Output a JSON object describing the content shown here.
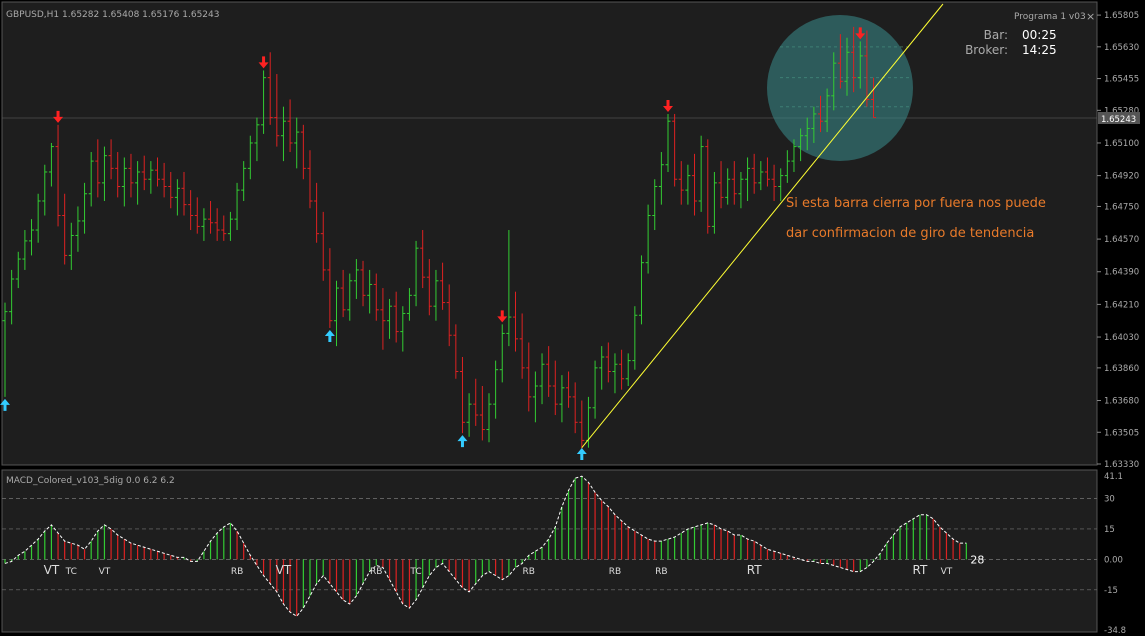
{
  "main_panel": {
    "header": "GBPUSD,H1  1.65282 1.65408 1.65176 1.65243",
    "indicator_name": "Programa 1 v03",
    "close_glyph": "×",
    "bar_label": "Bar:",
    "bar_value": "00:25",
    "broker_label": "Broker:",
    "broker_value": "14:25",
    "current_price_tag": "1.65243",
    "annotation_line1": "Si esta barra cierra por fuera nos puede",
    "annotation_line2": "dar confirmacion de giro de tendencia",
    "price_ticks": [
      "1.65805",
      "1.65630",
      "1.65455",
      "1.65280",
      "1.65100",
      "1.64920",
      "1.64750",
      "1.64570",
      "1.64390",
      "1.64210",
      "1.64030",
      "1.63860",
      "1.63680",
      "1.63505",
      "1.63330"
    ]
  },
  "sub_panel": {
    "header": "MACD_Colored_v103_5dig 0.0 6.2 6.2",
    "ticks": [
      "41.1",
      "30",
      "15",
      "0.00",
      "-15",
      "-34.8"
    ],
    "labels": [
      {
        "text": "VT",
        "bar": 7
      },
      {
        "text": "TC",
        "bar": 10
      },
      {
        "text": "VT",
        "bar": 15
      },
      {
        "text": "RB",
        "bar": 35
      },
      {
        "text": "VT",
        "bar": 42
      },
      {
        "text": "RB",
        "bar": 56
      },
      {
        "text": "TC",
        "bar": 62
      },
      {
        "text": "RB",
        "bar": 79
      },
      {
        "text": "RB",
        "bar": 92
      },
      {
        "text": "RB",
        "bar": 99
      },
      {
        "text": "RT",
        "bar": 113
      },
      {
        "text": "RT",
        "bar": 138
      },
      {
        "text": "VT",
        "bar": 142
      }
    ],
    "last_value": "28"
  },
  "colors": {
    "background": "#000000",
    "panel_bg": "#1e1e1e",
    "up_bar": "#33cc33",
    "down_bar": "#dd2222",
    "arrow_up": "#33ccff",
    "arrow_down": "#ff2222",
    "trendline": "#ffff33",
    "annotation_text": "#e87a2a",
    "highlight_circle": "#3a8e8e",
    "text": "#aaaaaa"
  },
  "chart_data": {
    "type": "ohlc",
    "symbol": "GBPUSD",
    "timeframe": "H1",
    "y_range": [
      1.6333,
      1.658
    ],
    "bars": [
      [
        1.6412,
        1.6422,
        1.637,
        1.6417
      ],
      [
        1.6417,
        1.644,
        1.641,
        1.6435
      ],
      [
        1.6435,
        1.645,
        1.643,
        1.6446
      ],
      [
        1.6446,
        1.6462,
        1.644,
        1.6456
      ],
      [
        1.6456,
        1.6468,
        1.6448,
        1.6462
      ],
      [
        1.6462,
        1.6482,
        1.6455,
        1.6478
      ],
      [
        1.6478,
        1.6498,
        1.647,
        1.6494
      ],
      [
        1.6494,
        1.651,
        1.6486,
        1.6508
      ],
      [
        1.6508,
        1.652,
        1.6464,
        1.647
      ],
      [
        1.647,
        1.6482,
        1.6443,
        1.6448
      ],
      [
        1.6448,
        1.6466,
        1.644,
        1.6459
      ],
      [
        1.6459,
        1.6475,
        1.645,
        1.6467
      ],
      [
        1.6467,
        1.6488,
        1.646,
        1.6482
      ],
      [
        1.6482,
        1.6505,
        1.6475,
        1.65
      ],
      [
        1.65,
        1.6512,
        1.648,
        1.6488
      ],
      [
        1.6488,
        1.6508,
        1.6478,
        1.6503
      ],
      [
        1.6503,
        1.6512,
        1.649,
        1.6496
      ],
      [
        1.6496,
        1.6505,
        1.648,
        1.6486
      ],
      [
        1.6486,
        1.6502,
        1.6475,
        1.6496
      ],
      [
        1.6496,
        1.6504,
        1.648,
        1.6488
      ],
      [
        1.6488,
        1.65,
        1.6476,
        1.6494
      ],
      [
        1.6494,
        1.6503,
        1.6484,
        1.649
      ],
      [
        1.649,
        1.65,
        1.6482,
        1.6495
      ],
      [
        1.6495,
        1.6502,
        1.6486,
        1.649
      ],
      [
        1.649,
        1.6499,
        1.648,
        1.6486
      ],
      [
        1.6486,
        1.6494,
        1.6474,
        1.648
      ],
      [
        1.648,
        1.649,
        1.647,
        1.6485
      ],
      [
        1.6485,
        1.6494,
        1.647,
        1.6476
      ],
      [
        1.6476,
        1.6484,
        1.6462,
        1.647
      ],
      [
        1.647,
        1.648,
        1.646,
        1.6464
      ],
      [
        1.6464,
        1.6474,
        1.6456,
        1.6468
      ],
      [
        1.6468,
        1.6478,
        1.646,
        1.6466
      ],
      [
        1.6466,
        1.6474,
        1.6456,
        1.6462
      ],
      [
        1.6462,
        1.647,
        1.6456,
        1.646
      ],
      [
        1.646,
        1.6472,
        1.6456,
        1.6468
      ],
      [
        1.6468,
        1.6488,
        1.6462,
        1.6484
      ],
      [
        1.6484,
        1.65,
        1.6478,
        1.6496
      ],
      [
        1.6496,
        1.6514,
        1.649,
        1.651
      ],
      [
        1.651,
        1.6524,
        1.65,
        1.652
      ],
      [
        1.652,
        1.655,
        1.6515,
        1.6546
      ],
      [
        1.6546,
        1.656,
        1.652,
        1.6524
      ],
      [
        1.6524,
        1.6548,
        1.6508,
        1.6514
      ],
      [
        1.6514,
        1.653,
        1.65,
        1.6522
      ],
      [
        1.6522,
        1.6534,
        1.6505,
        1.651
      ],
      [
        1.651,
        1.6524,
        1.6496,
        1.6516
      ],
      [
        1.6516,
        1.652,
        1.649,
        1.6496
      ],
      [
        1.6496,
        1.6506,
        1.6474,
        1.6478
      ],
      [
        1.6478,
        1.6488,
        1.6455,
        1.646
      ],
      [
        1.646,
        1.6472,
        1.6434,
        1.644
      ],
      [
        1.644,
        1.6452,
        1.6408,
        1.6412
      ],
      [
        1.6412,
        1.6434,
        1.6398,
        1.643
      ],
      [
        1.643,
        1.644,
        1.6414,
        1.6418
      ],
      [
        1.6418,
        1.6438,
        1.6412,
        1.6434
      ],
      [
        1.6434,
        1.6446,
        1.6424,
        1.644
      ],
      [
        1.644,
        1.6445,
        1.642,
        1.6426
      ],
      [
        1.6426,
        1.644,
        1.6416,
        1.6432
      ],
      [
        1.6432,
        1.6438,
        1.6412,
        1.6418
      ],
      [
        1.6418,
        1.643,
        1.6396,
        1.6412
      ],
      [
        1.6412,
        1.6424,
        1.6402,
        1.642
      ],
      [
        1.642,
        1.6428,
        1.64,
        1.6406
      ],
      [
        1.6406,
        1.642,
        1.6395,
        1.6416
      ],
      [
        1.6416,
        1.643,
        1.6412,
        1.6426
      ],
      [
        1.6426,
        1.6456,
        1.642,
        1.6452
      ],
      [
        1.6452,
        1.6462,
        1.643,
        1.6436
      ],
      [
        1.6436,
        1.6446,
        1.6415,
        1.642
      ],
      [
        1.642,
        1.644,
        1.6412,
        1.6434
      ],
      [
        1.6434,
        1.6444,
        1.6418,
        1.6422
      ],
      [
        1.6422,
        1.6432,
        1.6398,
        1.6404
      ],
      [
        1.6404,
        1.641,
        1.638,
        1.6384
      ],
      [
        1.6384,
        1.6392,
        1.635,
        1.6356
      ],
      [
        1.6356,
        1.6372,
        1.6348,
        1.6366
      ],
      [
        1.6366,
        1.638,
        1.6354,
        1.636
      ],
      [
        1.636,
        1.6376,
        1.6346,
        1.6352
      ],
      [
        1.6352,
        1.6372,
        1.6345,
        1.6366
      ],
      [
        1.6366,
        1.639,
        1.6358,
        1.6385
      ],
      [
        1.6385,
        1.641,
        1.6378,
        1.6405
      ],
      [
        1.6405,
        1.6462,
        1.6398,
        1.6414
      ],
      [
        1.6414,
        1.6428,
        1.6395,
        1.6402
      ],
      [
        1.6402,
        1.6416,
        1.638,
        1.6386
      ],
      [
        1.6386,
        1.64,
        1.6362,
        1.637
      ],
      [
        1.637,
        1.6384,
        1.6356,
        1.6376
      ],
      [
        1.6376,
        1.6394,
        1.6366,
        1.6388
      ],
      [
        1.6388,
        1.6398,
        1.637,
        1.6376
      ],
      [
        1.6376,
        1.639,
        1.636,
        1.6366
      ],
      [
        1.6366,
        1.6382,
        1.6356,
        1.6375
      ],
      [
        1.6375,
        1.6384,
        1.6364,
        1.637
      ],
      [
        1.637,
        1.6378,
        1.635,
        1.6356
      ],
      [
        1.6356,
        1.6368,
        1.634,
        1.6346
      ],
      [
        1.6346,
        1.637,
        1.6342,
        1.6364
      ],
      [
        1.6364,
        1.639,
        1.6358,
        1.6386
      ],
      [
        1.6386,
        1.6398,
        1.6374,
        1.6392
      ],
      [
        1.6392,
        1.64,
        1.6378,
        1.6384
      ],
      [
        1.6384,
        1.6394,
        1.6372,
        1.6388
      ],
      [
        1.6388,
        1.6396,
        1.6374,
        1.638
      ],
      [
        1.638,
        1.6394,
        1.6376,
        1.639
      ],
      [
        1.639,
        1.642,
        1.6385,
        1.6415
      ],
      [
        1.6415,
        1.6448,
        1.641,
        1.6444
      ],
      [
        1.6444,
        1.6476,
        1.6438,
        1.647
      ],
      [
        1.647,
        1.649,
        1.6462,
        1.6486
      ],
      [
        1.6486,
        1.6505,
        1.6476,
        1.6498
      ],
      [
        1.6498,
        1.6526,
        1.6494,
        1.6522
      ],
      [
        1.6522,
        1.6526,
        1.6486,
        1.649
      ],
      [
        1.649,
        1.65,
        1.6476,
        1.6484
      ],
      [
        1.6484,
        1.6498,
        1.6476,
        1.6492
      ],
      [
        1.6492,
        1.6504,
        1.647,
        1.6478
      ],
      [
        1.6478,
        1.6514,
        1.6472,
        1.6508
      ],
      [
        1.6508,
        1.6512,
        1.646,
        1.6464
      ],
      [
        1.6464,
        1.6494,
        1.646,
        1.6488
      ],
      [
        1.6488,
        1.65,
        1.6474,
        1.648
      ],
      [
        1.648,
        1.6496,
        1.6476,
        1.649
      ],
      [
        1.649,
        1.65,
        1.6476,
        1.6482
      ],
      [
        1.6482,
        1.6494,
        1.6474,
        1.649
      ],
      [
        1.649,
        1.6502,
        1.6478,
        1.6496
      ],
      [
        1.6496,
        1.6504,
        1.6482,
        1.6488
      ],
      [
        1.6488,
        1.65,
        1.6484,
        1.6494
      ],
      [
        1.6494,
        1.6502,
        1.6486,
        1.649
      ],
      [
        1.649,
        1.6498,
        1.6478,
        1.6486
      ],
      [
        1.6486,
        1.6496,
        1.6478,
        1.6492
      ],
      [
        1.6492,
        1.6506,
        1.6488,
        1.65
      ],
      [
        1.65,
        1.6512,
        1.6494,
        1.6508
      ],
      [
        1.6508,
        1.6518,
        1.65,
        1.6514
      ],
      [
        1.6514,
        1.6524,
        1.6506,
        1.6518
      ],
      [
        1.6518,
        1.653,
        1.651,
        1.6526
      ],
      [
        1.6526,
        1.6536,
        1.6516,
        1.6522
      ],
      [
        1.6522,
        1.654,
        1.6516,
        1.6536
      ],
      [
        1.6536,
        1.656,
        1.6528,
        1.6554
      ],
      [
        1.6554,
        1.657,
        1.654,
        1.6544
      ],
      [
        1.6544,
        1.6568,
        1.6536,
        1.656
      ],
      [
        1.656,
        1.6574,
        1.6538,
        1.6546
      ],
      [
        1.6546,
        1.6566,
        1.654,
        1.6558
      ],
      [
        1.6558,
        1.6572,
        1.653,
        1.6534
      ],
      [
        1.6534,
        1.6546,
        1.6524,
        1.6524
      ]
    ],
    "arrows": [
      {
        "bar": 0,
        "dir": "up"
      },
      {
        "bar": 8,
        "dir": "down"
      },
      {
        "bar": 39,
        "dir": "down"
      },
      {
        "bar": 49,
        "dir": "up"
      },
      {
        "bar": 69,
        "dir": "up"
      },
      {
        "bar": 75,
        "dir": "down"
      },
      {
        "bar": 87,
        "dir": "up"
      },
      {
        "bar": 100,
        "dir": "down"
      },
      {
        "bar": 129,
        "dir": "down"
      }
    ],
    "trendline": {
      "from": {
        "bar": 87,
        "price": 1.6342
      },
      "to": {
        "bar": 140,
        "price": 1.658
      }
    },
    "macd": [
      -2,
      -1,
      2,
      4,
      7,
      10,
      14,
      17,
      13,
      9,
      8,
      7,
      5,
      9,
      14,
      17,
      15,
      12,
      10,
      8,
      7,
      6,
      5,
      4,
      3,
      2,
      1,
      1,
      -1,
      -1,
      4,
      9,
      13,
      16,
      18,
      14,
      8,
      2,
      -3,
      -8,
      -12,
      -16,
      -22,
      -26,
      -28,
      -24,
      -18,
      -12,
      -8,
      -12,
      -16,
      -20,
      -22,
      -18,
      -12,
      -6,
      -3,
      -4,
      -10,
      -16,
      -22,
      -24,
      -20,
      -14,
      -8,
      -4,
      -2,
      -6,
      -10,
      -14,
      -16,
      -12,
      -8,
      -6,
      -8,
      -10,
      -8,
      -4,
      -2,
      2,
      4,
      6,
      10,
      16,
      26,
      34,
      40,
      41,
      38,
      33,
      29,
      26,
      22,
      19,
      16,
      14,
      12,
      10,
      9,
      9,
      10,
      11,
      13,
      15,
      16,
      17,
      18,
      17,
      15,
      14,
      12,
      12,
      10,
      9,
      7,
      5,
      4,
      3,
      2,
      1,
      0,
      -1,
      -1,
      -2,
      -2,
      -3,
      -4,
      -5,
      -6,
      -6,
      -4,
      -1,
      3,
      8,
      12,
      16,
      18,
      20,
      22,
      22,
      20,
      16,
      13,
      10,
      8,
      8
    ]
  }
}
